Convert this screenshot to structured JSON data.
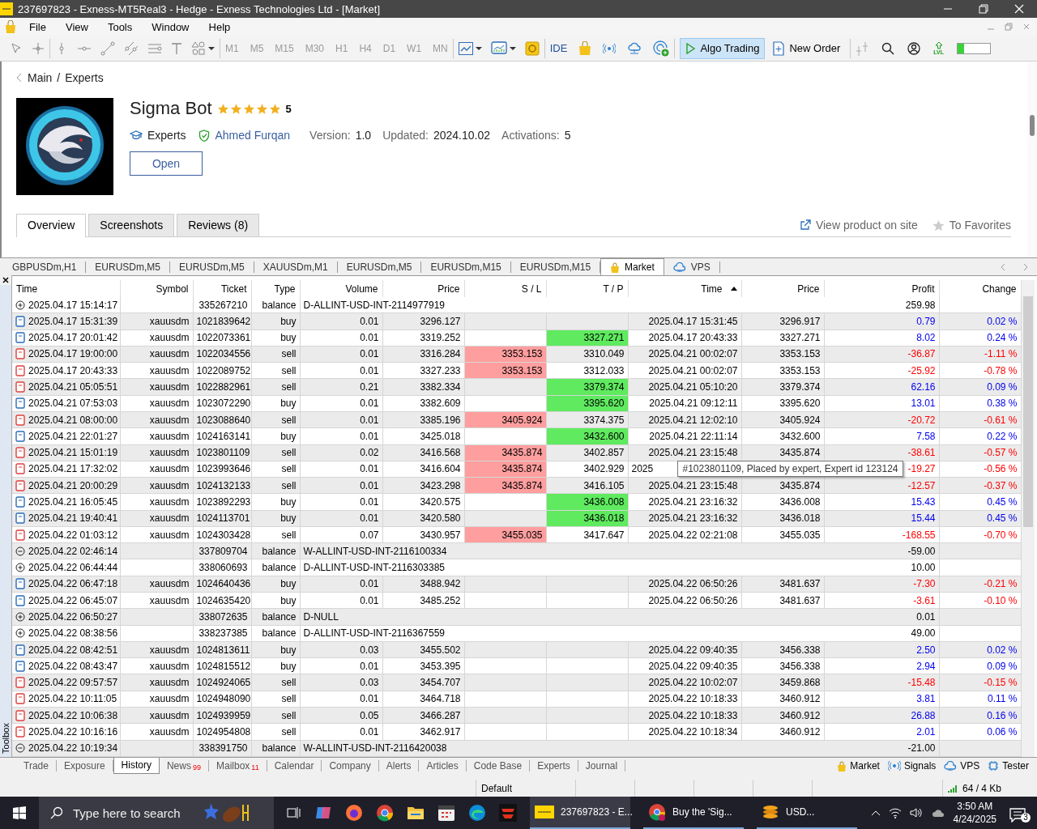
{
  "window": {
    "title": "237697823 - Exness-MT5Real3 - Hedge - Exness Technologies Ltd - [Market]"
  },
  "menu": [
    "File",
    "View",
    "Tools",
    "Window",
    "Help"
  ],
  "toolbar": {
    "timeframes": [
      {
        "label": "M1",
        "disabled": true
      },
      {
        "label": "M5",
        "disabled": true
      },
      {
        "label": "M15",
        "disabled": true
      },
      {
        "label": "M30",
        "disabled": true
      },
      {
        "label": "H1",
        "disabled": true
      },
      {
        "label": "H4",
        "disabled": true
      },
      {
        "label": "D1",
        "disabled": true
      },
      {
        "label": "W1",
        "disabled": true
      },
      {
        "label": "MN",
        "disabled": true
      }
    ],
    "ide": "IDE",
    "algo_trading": {
      "label": "Algo Trading",
      "on": true
    },
    "new_order": "New Order",
    "lvl": "LVL"
  },
  "market": {
    "breadcrumb": {
      "items": [
        "Main",
        "Experts"
      ],
      "separator": "/"
    },
    "product": {
      "title": "Sigma Bot",
      "stars": 5,
      "rating": "5",
      "category": "Experts",
      "author": "Ahmed Furqan",
      "meta": [
        {
          "label": "Version:",
          "value": "1.0"
        },
        {
          "label": "Updated:",
          "value": "2024.10.02"
        },
        {
          "label": "Activations:",
          "value": "5"
        }
      ],
      "open_button": "Open"
    },
    "tabs": [
      {
        "label": "Overview",
        "selected": true
      },
      {
        "label": "Screenshots",
        "selected": false
      },
      {
        "label": "Reviews (8)",
        "selected": false
      }
    ],
    "links": [
      {
        "label": "View product on site",
        "kind": "external"
      },
      {
        "label": "To Favorites",
        "kind": "favorite"
      }
    ]
  },
  "chart_tabs": [
    {
      "label": "GBPUSDm,H1",
      "kind": "chart",
      "selected": false
    },
    {
      "label": "EURUSDm,M5",
      "kind": "chart",
      "selected": false
    },
    {
      "label": "EURUSDm,M5",
      "kind": "chart",
      "selected": false
    },
    {
      "label": "XAUUSDm,M1",
      "kind": "chart",
      "selected": false
    },
    {
      "label": "EURUSDm,M5",
      "kind": "chart",
      "selected": false
    },
    {
      "label": "EURUSDm,M15",
      "kind": "chart",
      "selected": false
    },
    {
      "label": "EURUSDm,M15",
      "kind": "chart",
      "selected": false
    },
    {
      "label": "Market",
      "kind": "market",
      "selected": true
    },
    {
      "label": "VPS",
      "kind": "vps",
      "selected": false
    }
  ],
  "toolbox": {
    "label": "Toolbox"
  },
  "history": {
    "columns": [
      {
        "label": "Time",
        "sorted": false
      },
      {
        "label": "Symbol",
        "sorted": false
      },
      {
        "label": "Ticket",
        "sorted": false
      },
      {
        "label": "Type",
        "sorted": false
      },
      {
        "label": "Volume",
        "sorted": false
      },
      {
        "label": "Price",
        "sorted": false
      },
      {
        "label": "S / L",
        "sorted": false
      },
      {
        "label": "T / P",
        "sorted": false
      },
      {
        "label": "Time",
        "sorted": true
      },
      {
        "label": "Price",
        "sorted": false
      },
      {
        "label": "Profit",
        "sorted": false
      },
      {
        "label": "Change",
        "sorted": false
      }
    ],
    "rows": [
      {
        "kind": "deposit",
        "time": "2025.04.17 15:14:17",
        "ticket": "335267210",
        "type": "balance",
        "comment": "D-ALLINT-USD-INT-2114977919",
        "profit": "259.98"
      },
      {
        "kind": "buy",
        "time": "2025.04.17 15:31:39",
        "symbol": "xauusdm",
        "ticket": "1021839642",
        "type": "buy",
        "volume": "0.01",
        "price": "3296.127",
        "sl_hit": false,
        "tp_hit": false,
        "time2": "2025.04.17 15:31:45",
        "price2": "3296.917",
        "profit": "0.79",
        "change": "0.02 %",
        "loss": false
      },
      {
        "kind": "buy",
        "time": "2025.04.17 20:01:42",
        "symbol": "xauusdm",
        "ticket": "1022073361",
        "type": "buy",
        "volume": "0.01",
        "price": "3319.252",
        "tp": "3327.271",
        "sl_hit": false,
        "tp_hit": true,
        "time2": "2025.04.17 20:43:33",
        "price2": "3327.271",
        "profit": "8.02",
        "change": "0.24 %",
        "loss": false
      },
      {
        "kind": "sell",
        "time": "2025.04.17 19:00:00",
        "symbol": "xauusdm",
        "ticket": "1022034556",
        "type": "sell",
        "volume": "0.01",
        "price": "3316.284",
        "sl": "3353.153",
        "tp": "3310.049",
        "sl_hit": true,
        "tp_hit": false,
        "time2": "2025.04.21 00:02:07",
        "price2": "3353.153",
        "profit": "-36.87",
        "change": "-1.11 %",
        "loss": true
      },
      {
        "kind": "sell",
        "time": "2025.04.17 20:43:33",
        "symbol": "xauusdm",
        "ticket": "1022089752",
        "type": "sell",
        "volume": "0.01",
        "price": "3327.233",
        "sl": "3353.153",
        "tp": "3312.033",
        "sl_hit": true,
        "tp_hit": false,
        "time2": "2025.04.21 00:02:07",
        "price2": "3353.153",
        "profit": "-25.92",
        "change": "-0.78 %",
        "loss": true
      },
      {
        "kind": "sell",
        "time": "2025.04.21 05:05:51",
        "symbol": "xauusdm",
        "ticket": "1022882961",
        "type": "sell",
        "volume": "0.21",
        "price": "3382.334",
        "tp": "3379.374",
        "sl_hit": false,
        "tp_hit": true,
        "time2": "2025.04.21 05:10:20",
        "price2": "3379.374",
        "profit": "62.16",
        "change": "0.09 %",
        "loss": false
      },
      {
        "kind": "buy",
        "time": "2025.04.21 07:53:03",
        "symbol": "xauusdm",
        "ticket": "1023072290",
        "type": "buy",
        "volume": "0.01",
        "price": "3382.609",
        "tp": "3395.620",
        "sl_hit": false,
        "tp_hit": true,
        "time2": "2025.04.21 09:12:11",
        "price2": "3395.620",
        "profit": "13.01",
        "change": "0.38 %",
        "loss": false
      },
      {
        "kind": "sell",
        "time": "2025.04.21 08:00:00",
        "symbol": "xauusdm",
        "ticket": "1023088640",
        "type": "sell",
        "volume": "0.01",
        "price": "3385.196",
        "sl": "3405.924",
        "tp": "3374.375",
        "sl_hit": true,
        "tp_hit": false,
        "time2": "2025.04.21 12:02:10",
        "price2": "3405.924",
        "profit": "-20.72",
        "change": "-0.61 %",
        "loss": true
      },
      {
        "kind": "buy",
        "time": "2025.04.21 22:01:27",
        "symbol": "xauusdm",
        "ticket": "1024163141",
        "type": "buy",
        "volume": "0.01",
        "price": "3425.018",
        "tp": "3432.600",
        "sl_hit": false,
        "tp_hit": true,
        "time2": "2025.04.21 22:11:14",
        "price2": "3432.600",
        "profit": "7.58",
        "change": "0.22 %",
        "loss": false
      },
      {
        "kind": "sell",
        "time": "2025.04.21 15:01:19",
        "symbol": "xauusdm",
        "ticket": "1023801109",
        "type": "sell",
        "volume": "0.02",
        "price": "3416.568",
        "sl": "3435.874",
        "tp": "3402.857",
        "sl_hit": true,
        "tp_hit": false,
        "time2": "2025.04.21 23:15:48",
        "price2": "3435.874",
        "profit": "-38.61",
        "change": "-0.57 %",
        "loss": true
      },
      {
        "kind": "sell",
        "time": "2025.04.21 17:32:02",
        "symbol": "xauusdm",
        "ticket": "1023993646",
        "type": "sell",
        "volume": "0.01",
        "price": "3416.604",
        "sl": "3435.874",
        "tp": "3402.929",
        "sl_hit": true,
        "tp_hit": false,
        "time2": "2025",
        "profit": "-19.27",
        "change": "-0.56 %",
        "loss": true,
        "tooltip": "#1023801109, Placed by expert, Expert id 123124"
      },
      {
        "kind": "sell",
        "time": "2025.04.21 20:00:29",
        "symbol": "xauusdm",
        "ticket": "1024132133",
        "type": "sell",
        "volume": "0.01",
        "price": "3423.298",
        "sl": "3435.874",
        "tp": "3416.105",
        "sl_hit": true,
        "tp_hit": false,
        "time2": "2025.04.21 23:15:48",
        "price2": "3435.874",
        "profit": "-12.57",
        "change": "-0.37 %",
        "loss": true
      },
      {
        "kind": "buy",
        "time": "2025.04.21 16:05:45",
        "symbol": "xauusdm",
        "ticket": "1023892293",
        "type": "buy",
        "volume": "0.01",
        "price": "3420.575",
        "tp": "3436.008",
        "sl_hit": false,
        "tp_hit": true,
        "time2": "2025.04.21 23:16:32",
        "price2": "3436.008",
        "profit": "15.43",
        "change": "0.45 %",
        "loss": false
      },
      {
        "kind": "buy",
        "time": "2025.04.21 19:40:41",
        "symbol": "xauusdm",
        "ticket": "1024113701",
        "type": "buy",
        "volume": "0.01",
        "price": "3420.580",
        "tp": "3436.018",
        "sl_hit": false,
        "tp_hit": true,
        "time2": "2025.04.21 23:16:32",
        "price2": "3436.018",
        "profit": "15.44",
        "change": "0.45 %",
        "loss": false
      },
      {
        "kind": "sell",
        "time": "2025.04.22 01:03:12",
        "symbol": "xauusdm",
        "ticket": "1024303428",
        "type": "sell",
        "volume": "0.07",
        "price": "3430.957",
        "sl": "3455.035",
        "tp": "3417.647",
        "sl_hit": true,
        "tp_hit": false,
        "time2": "2025.04.22 02:21:08",
        "price2": "3455.035",
        "profit": "-168.55",
        "change": "-0.70 %",
        "loss": true
      },
      {
        "kind": "withdrawal",
        "time": "2025.04.22 02:46:14",
        "ticket": "337809704",
        "type": "balance",
        "comment": "W-ALLINT-USD-INT-2116100334",
        "profit": "-59.00"
      },
      {
        "kind": "deposit",
        "time": "2025.04.22 06:44:44",
        "ticket": "338060693",
        "type": "balance",
        "comment": "D-ALLINT-USD-INT-2116303385",
        "profit": "10.00"
      },
      {
        "kind": "buy",
        "time": "2025.04.22 06:47:18",
        "symbol": "xauusdm",
        "ticket": "1024640436",
        "type": "buy",
        "volume": "0.01",
        "price": "3488.942",
        "sl_hit": false,
        "tp_hit": false,
        "time2": "2025.04.22 06:50:26",
        "price2": "3481.637",
        "profit": "-7.30",
        "change": "-0.21 %",
        "loss": true
      },
      {
        "kind": "buy",
        "time": "2025.04.22 06:45:07",
        "symbol": "xauusdm",
        "ticket": "1024635420",
        "type": "buy",
        "volume": "0.01",
        "price": "3485.252",
        "sl_hit": false,
        "tp_hit": false,
        "time2": "2025.04.22 06:50:26",
        "price2": "3481.637",
        "profit": "-3.61",
        "change": "-0.10 %",
        "loss": true
      },
      {
        "kind": "deposit",
        "time": "2025.04.22 06:50:27",
        "ticket": "338072635",
        "type": "balance",
        "comment": "D-NULL",
        "profit": "0.01"
      },
      {
        "kind": "deposit",
        "time": "2025.04.22 08:38:56",
        "ticket": "338237385",
        "type": "balance",
        "comment": "D-ALLINT-USD-INT-2116367559",
        "profit": "49.00"
      },
      {
        "kind": "buy",
        "time": "2025.04.22 08:42:51",
        "symbol": "xauusdm",
        "ticket": "1024813611",
        "type": "buy",
        "volume": "0.03",
        "price": "3455.502",
        "sl_hit": false,
        "tp_hit": false,
        "time2": "2025.04.22 09:40:35",
        "price2": "3456.338",
        "profit": "2.50",
        "change": "0.02 %",
        "loss": false
      },
      {
        "kind": "buy",
        "time": "2025.04.22 08:43:47",
        "symbol": "xauusdm",
        "ticket": "1024815512",
        "type": "buy",
        "volume": "0.01",
        "price": "3453.395",
        "sl_hit": false,
        "tp_hit": false,
        "time2": "2025.04.22 09:40:35",
        "price2": "3456.338",
        "profit": "2.94",
        "change": "0.09 %",
        "loss": false
      },
      {
        "kind": "sell",
        "time": "2025.04.22 09:57:57",
        "symbol": "xauusdm",
        "ticket": "1024924065",
        "type": "sell",
        "volume": "0.03",
        "price": "3454.707",
        "sl_hit": false,
        "tp_hit": false,
        "time2": "2025.04.22 10:02:07",
        "price2": "3459.868",
        "profit": "-15.48",
        "change": "-0.15 %",
        "loss": true
      },
      {
        "kind": "sell",
        "time": "2025.04.22 10:11:05",
        "symbol": "xauusdm",
        "ticket": "1024948090",
        "type": "sell",
        "volume": "0.01",
        "price": "3464.718",
        "sl_hit": false,
        "tp_hit": false,
        "time2": "2025.04.22 10:18:33",
        "price2": "3460.912",
        "profit": "3.81",
        "change": "0.11 %",
        "loss": false
      },
      {
        "kind": "sell",
        "time": "2025.04.22 10:06:38",
        "symbol": "xauusdm",
        "ticket": "1024939959",
        "type": "sell",
        "volume": "0.05",
        "price": "3466.287",
        "sl_hit": false,
        "tp_hit": false,
        "time2": "2025.04.22 10:18:33",
        "price2": "3460.912",
        "profit": "26.88",
        "change": "0.16 %",
        "loss": false
      },
      {
        "kind": "sell",
        "time": "2025.04.22 10:16:16",
        "symbol": "xauusdm",
        "ticket": "1024954808",
        "type": "sell",
        "volume": "0.01",
        "price": "3462.917",
        "sl_hit": false,
        "tp_hit": false,
        "time2": "2025.04.22 10:18:34",
        "price2": "3460.912",
        "profit": "2.01",
        "change": "0.06 %",
        "loss": false
      },
      {
        "kind": "withdrawal",
        "time": "2025.04.22 10:19:34",
        "ticket": "338391750",
        "type": "balance",
        "comment": "W-ALLINT-USD-INT-2116420038",
        "profit": "-21.00"
      }
    ]
  },
  "bottom_tabs": [
    {
      "label": "Trade",
      "selected": false
    },
    {
      "label": "Exposure",
      "selected": false
    },
    {
      "label": "History",
      "selected": true
    },
    {
      "label": "News",
      "badge": "99",
      "selected": false
    },
    {
      "label": "Mailbox",
      "badge": "11",
      "selected": false
    },
    {
      "label": "Calendar",
      "selected": false
    },
    {
      "label": "Company",
      "selected": false
    },
    {
      "label": "Alerts",
      "selected": false
    },
    {
      "label": "Articles",
      "selected": false
    },
    {
      "label": "Code Base",
      "selected": false
    },
    {
      "label": "Experts",
      "selected": false
    },
    {
      "label": "Journal",
      "selected": false
    }
  ],
  "bottom_links": [
    {
      "label": "Market",
      "kind": "market"
    },
    {
      "label": "Signals",
      "kind": "signals"
    },
    {
      "label": "VPS",
      "kind": "vps"
    },
    {
      "label": "Tester",
      "kind": "tester"
    }
  ],
  "status_bar": {
    "profile": "Default",
    "traffic": "64 / 4 Kb"
  },
  "taskbar": {
    "search_placeholder": "Type here to search",
    "windows": [
      {
        "label": "237697823 - E...",
        "kind": "exness",
        "selected": true
      },
      {
        "label": "Buy the 'Sig...",
        "kind": "chrome",
        "selected": false
      },
      {
        "label": "USD...",
        "kind": "stack",
        "selected": false
      }
    ],
    "time": "3:50 AM",
    "date": "4/24/2025",
    "notifications": "3"
  }
}
